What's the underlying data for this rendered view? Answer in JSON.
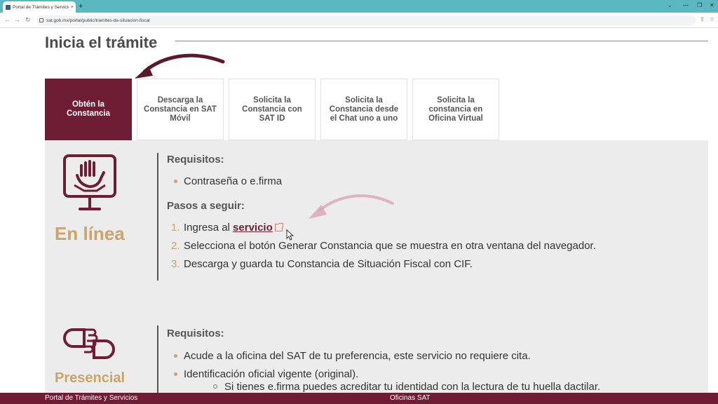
{
  "browser": {
    "tab_title": "Portal de Trámites y Servicios",
    "tab_close": "×",
    "new_tab": "+",
    "url": "sat.gob.mx/portal/public/tramites-de-situacion-fiscal",
    "back": "←",
    "forward": "→",
    "reload": "↻",
    "window_controls": [
      "⌄",
      "—",
      "❐",
      "✕"
    ]
  },
  "page": {
    "title": "Inicia el trámite"
  },
  "tabs": [
    {
      "label": "Obtén la Constancia",
      "active": true
    },
    {
      "label": "Descarga la Constancia en SAT Móvil",
      "active": false
    },
    {
      "label": "Solicita la Constancia con SAT ID",
      "active": false
    },
    {
      "label": "Solicita la Constancia desde el Chat uno a uno",
      "active": false
    },
    {
      "label": "Solicita la constancia en Oficina Virtual",
      "active": false
    }
  ],
  "online": {
    "title": "En línea",
    "requirements_heading": "Requisitos:",
    "requirements": [
      "Contraseña o e.firma"
    ],
    "steps_heading": "Pasos a seguir:",
    "steps": [
      {
        "num": "1.",
        "pre": "Ingresa al ",
        "link": "servicio",
        "post": " ."
      },
      {
        "num": "2.",
        "text": "Selecciona el botón Generar Constancia que se muestra en otra ventana del navegador."
      },
      {
        "num": "3.",
        "text": "Descarga y guarda tu Constancia de Situación Fiscal con CIF."
      }
    ]
  },
  "presencial": {
    "title": "Presencial",
    "requirements_heading": "Requisitos:",
    "requirements": [
      "Acude a la oficina del SAT de tu preferencia, este servicio no requiere cita.",
      "Identificación oficial vigente (original)."
    ],
    "sub_requirements": [
      "Si tienes e.firma puedes acreditar tu identidad con la lectura de tu huella dactilar."
    ]
  },
  "footer": {
    "left": "Portal de Trámites y Servicios",
    "center": "Oficinas SAT"
  },
  "colors": {
    "brand": "#6f1d35",
    "gold": "#c9a46c",
    "chrome": "#5bb8c1"
  }
}
